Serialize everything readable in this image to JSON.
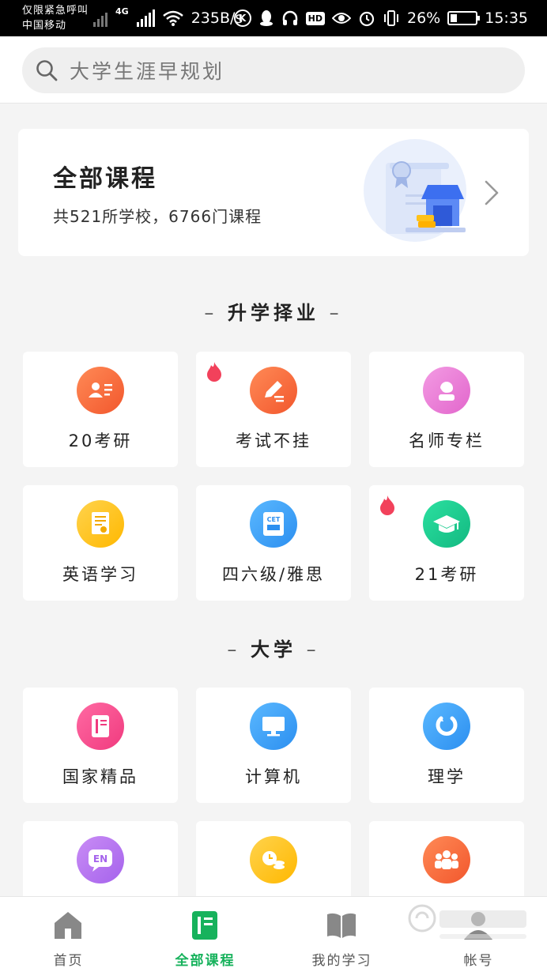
{
  "status_bar": {
    "carrier_line1": "仅限紧急呼叫",
    "carrier_line2": "中国移动",
    "network": "4G",
    "speed": "235B/s",
    "battery": "26%",
    "time": "15:35"
  },
  "search": {
    "placeholder": "大学生涯早规划"
  },
  "banner": {
    "title": "全部课程",
    "subtitle": "共521所学校，6766门课程"
  },
  "sections": [
    {
      "title": "升学择业",
      "items": [
        {
          "label": "20考研",
          "icon": "id-card-icon",
          "hot": false
        },
        {
          "label": "考试不挂",
          "icon": "pencil-note-icon",
          "hot": true
        },
        {
          "label": "名师专栏",
          "icon": "teacher-icon",
          "hot": false
        },
        {
          "label": "英语学习",
          "icon": "certificate-icon",
          "hot": false
        },
        {
          "label": "四六级/雅思",
          "icon": "cet-book-icon",
          "hot": false
        },
        {
          "label": "21考研",
          "icon": "graduation-cap-icon",
          "hot": true
        }
      ]
    },
    {
      "title": "大学",
      "items": [
        {
          "label": "国家精品",
          "icon": "book-icon",
          "hot": false
        },
        {
          "label": "计算机",
          "icon": "monitor-icon",
          "hot": false
        },
        {
          "label": "理学",
          "icon": "magnet-icon",
          "hot": false
        },
        {
          "label": "",
          "icon": "en-bubble-icon",
          "hot": false
        },
        {
          "label": "",
          "icon": "finance-icon",
          "hot": false
        },
        {
          "label": "",
          "icon": "people-icon",
          "hot": false
        }
      ]
    }
  ],
  "colors": {
    "accent_green": "#17b25c",
    "orange": "#f7693a",
    "pink": "#e96fd1",
    "yellow": "#ffc21a",
    "blue": "#3da9f6",
    "teal": "#19c98e",
    "magenta": "#f34d8d",
    "purple": "#b877f0"
  },
  "bottom_nav": [
    {
      "label": "首页",
      "icon": "home-icon",
      "active": false
    },
    {
      "label": "全部课程",
      "icon": "courses-icon",
      "active": true
    },
    {
      "label": "我的学习",
      "icon": "open-book-icon",
      "active": false
    },
    {
      "label": "帐号",
      "icon": "user-icon",
      "active": false
    }
  ]
}
